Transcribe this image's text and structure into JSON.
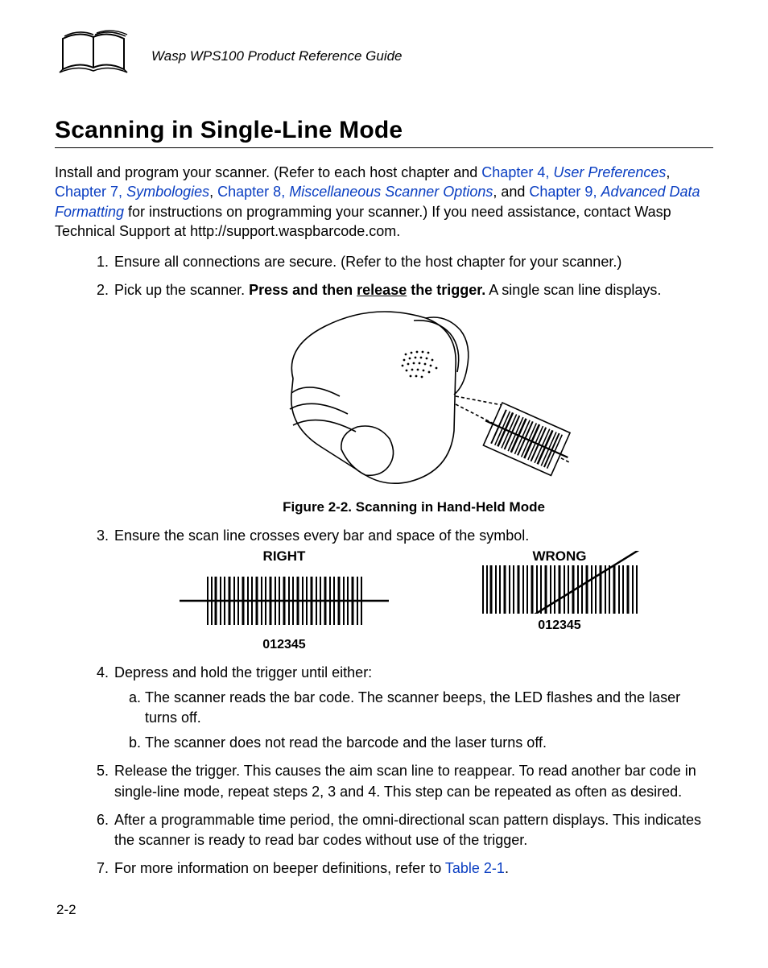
{
  "header": {
    "guide_title": "Wasp WPS100 Product Reference Guide"
  },
  "section_title": "Scanning in Single-Line Mode",
  "intro": {
    "p1a": "Install and program your scanner. (Refer to each host chapter and ",
    "l1a": "Chapter 4, ",
    "l1b": "User Preferences",
    "p1b": ", ",
    "l2a": "Chapter 7, ",
    "l2b": "Symbologies",
    "p1c": ", ",
    "l3a": "Chapter 8, ",
    "l3b": "Miscellaneous Scanner Options",
    "p1d": ", and ",
    "l4a": "Chapter 9, ",
    "l4b": "Advanced Data Formatting",
    "p1e": " for instructions on programming your scanner.) If you need assistance, contact Wasp Technical Support at http://support.waspbarcode.com."
  },
  "steps": {
    "s1": "Ensure all connections are secure. (Refer to the host chapter for your scanner.)",
    "s2a": "Pick up the scanner. ",
    "s2b": "Press and then ",
    "s2c": "release",
    "s2d": " the trigger.",
    "s2e": " A single scan line displays.",
    "s3": "Ensure the scan line crosses every bar and space of the symbol.",
    "s4": "Depress and hold the trigger until either:",
    "s4a": "The scanner reads the bar code. The scanner beeps, the LED flashes and the laser turns off.",
    "s4b": "The scanner does not read the barcode and the laser turns off.",
    "s5": "Release the trigger. This causes the aim scan line to reappear. To read another bar code in single-line mode, repeat steps 2, 3 and 4. This step can be repeated as often as desired.",
    "s6": "After a programmable time period, the omni-directional scan pattern displays. This indicates the scanner is ready to read bar codes without use of the trigger.",
    "s7a": "For more information on beeper definitions, refer to ",
    "s7b": "Table 2-1",
    "s7c": "."
  },
  "figure": {
    "caption": "Figure 2-2.  Scanning in Hand-Held Mode"
  },
  "rw": {
    "right_label": "RIGHT",
    "wrong_label": "WRONG",
    "code": "012345"
  },
  "page_number": "2-2"
}
